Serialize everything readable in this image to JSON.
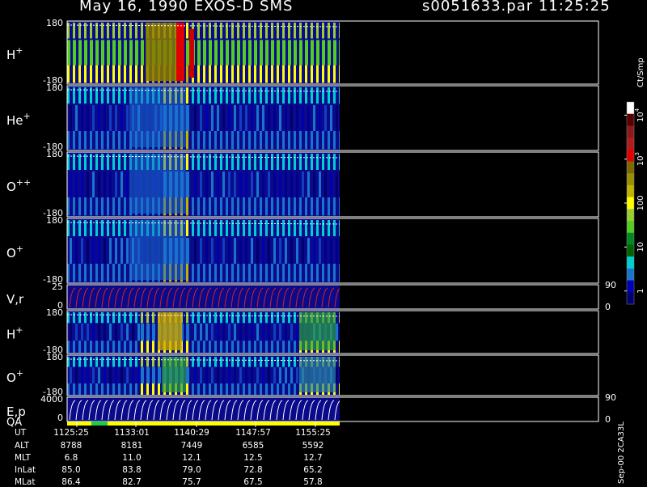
{
  "header": {
    "title": "May 16, 1990   EXOS-D SMS",
    "file": "s0051633.par  11:25:25"
  },
  "chart_data": {
    "type": "heatmap",
    "panels": [
      {
        "name": "H",
        "sup": "+",
        "ymax": "180",
        "ymin": "-180"
      },
      {
        "name": "He",
        "sup": "+",
        "ymax": "180",
        "ymin": "-180"
      },
      {
        "name": "O",
        "sup": "++",
        "ymax": "180",
        "ymin": "-180"
      },
      {
        "name": "O",
        "sup": "+",
        "ymax": "180",
        "ymin": "-180"
      },
      {
        "name": "V,r",
        "sup": "",
        "ymax": "25",
        "ymin": "0",
        "right_max": "90",
        "right_min": "0"
      },
      {
        "name": "H",
        "sup": "+",
        "ymax": "180",
        "ymin": "-180"
      },
      {
        "name": "O",
        "sup": "+",
        "ymax": "180",
        "ymin": "-180"
      },
      {
        "name": "E,p",
        "sup": "",
        "ymax": "4000",
        "ymin": "0",
        "right_max": "90",
        "right_min": "0"
      }
    ],
    "qa_label": "QA",
    "colorbar": {
      "unit_label": "Ct/Smp",
      "ticks": [
        {
          "base": "10",
          "exp": "4",
          "value": 10000
        },
        {
          "base": "10",
          "exp": "3",
          "value": 1000
        },
        {
          "base": "100",
          "exp": "",
          "value": 100
        },
        {
          "base": "10",
          "exp": "",
          "value": 10
        },
        {
          "base": "1",
          "exp": "",
          "value": 1
        }
      ],
      "scale": "log",
      "range": [
        0.5,
        20000
      ]
    },
    "x_axis": {
      "rows": [
        {
          "label": "UT",
          "values": [
            "1125:25",
            "1133:01",
            "1140:29",
            "1147:57",
            "1155:25"
          ]
        },
        {
          "label": "ALT",
          "values": [
            "8788",
            "8181",
            "7449",
            "6585",
            "5592"
          ]
        },
        {
          "label": "MLT",
          "values": [
            "6.8",
            "11.0",
            "12.1",
            "12.5",
            "12.7"
          ]
        },
        {
          "label": "InLat",
          "values": [
            "85.0",
            "83.8",
            "79.0",
            "72.8",
            "65.2"
          ]
        },
        {
          "label": "MLat",
          "values": [
            "86.4",
            "82.7",
            "75.7",
            "67.5",
            "57.8"
          ]
        }
      ]
    },
    "footer_tag": "Sep-00 2CA33L",
    "colors": {
      "background": "#000000",
      "colorbar": [
        "#ffffff",
        "#5a0000",
        "#8b1a1a",
        "#b01c1c",
        "#e00000",
        "#7a6a00",
        "#9a8f00",
        "#c0b400",
        "#ffff00",
        "#9acd32",
        "#55cc22",
        "#008b22",
        "#006400",
        "#00ced1",
        "#1874cd",
        "#0000b0",
        "#000070"
      ]
    }
  }
}
